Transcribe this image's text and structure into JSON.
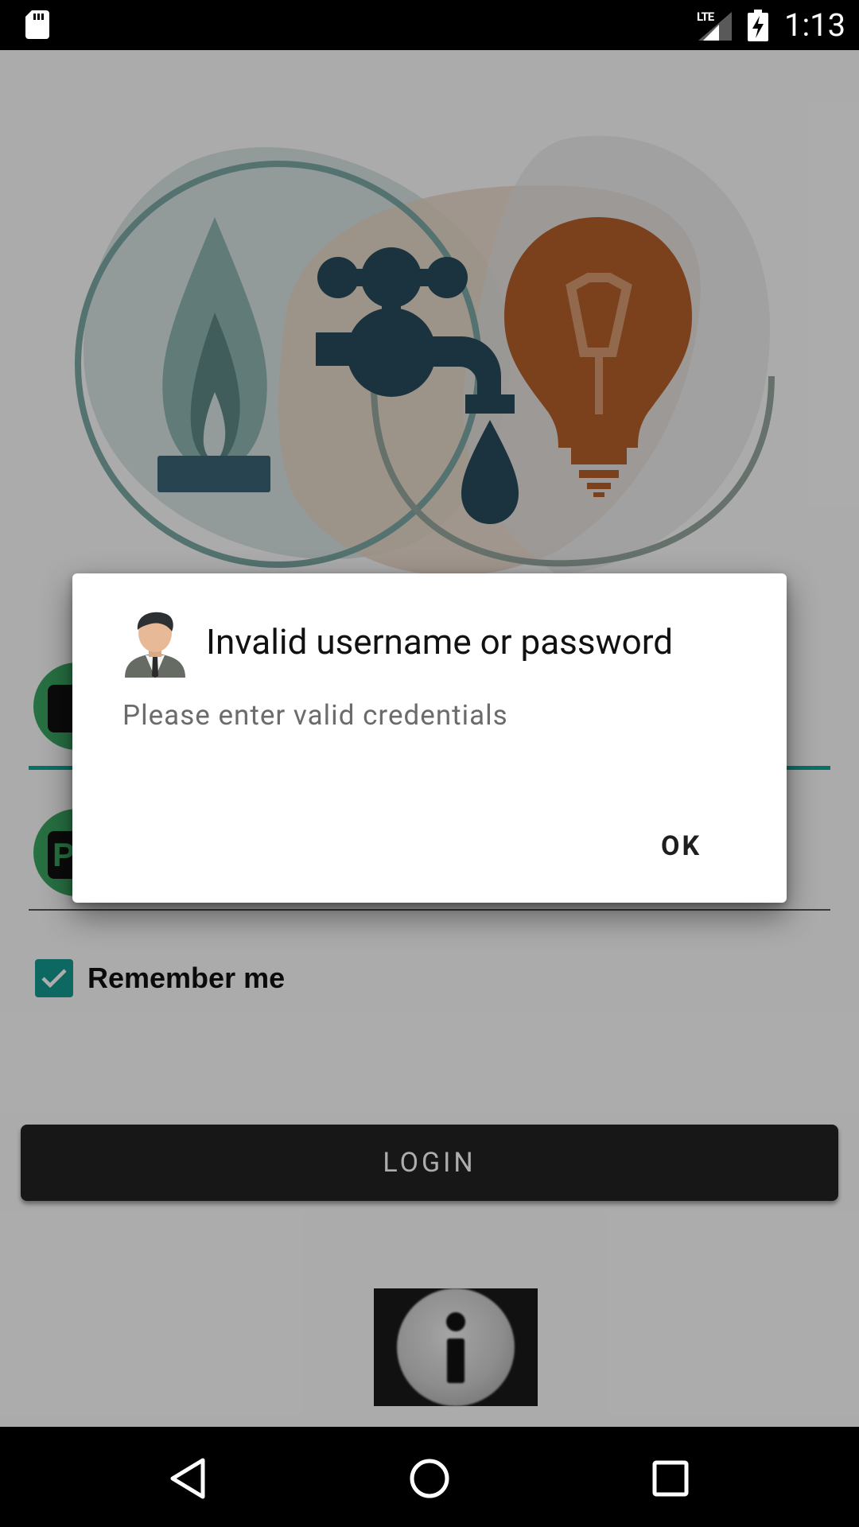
{
  "status_bar": {
    "network": "LTE",
    "time": "1:13"
  },
  "form": {
    "username_icon_letter": "",
    "password_icon_letter": "P",
    "remember_label": "Remember me",
    "remember_checked": true,
    "login_label": "LOGIN"
  },
  "dialog": {
    "title": "Invalid username or password",
    "message": "Please enter valid credentials",
    "ok_label": "OK"
  },
  "colors": {
    "accent": "#149a8f",
    "hero_gas": "#6e9896",
    "hero_water": "#284a5e",
    "hero_bulb": "#b4602a",
    "icon_green": "#3aa562"
  },
  "icons": {
    "status_left": "sd-card-icon",
    "hero": [
      "gas-flame-icon",
      "water-tap-icon",
      "light-bulb-icon"
    ],
    "info": "info-icon",
    "nav": [
      "back-icon",
      "home-icon",
      "recents-icon"
    ]
  }
}
